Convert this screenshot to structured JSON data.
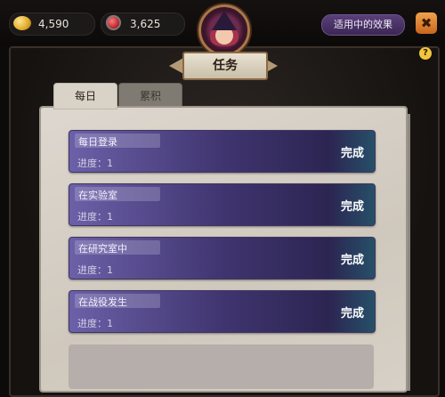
{
  "currency": {
    "gold": "4,590",
    "potion": "3,625"
  },
  "header": {
    "effects_button": "适用中的效果",
    "close_label": "✖",
    "title": "任务",
    "help_label": "?"
  },
  "tabs": [
    {
      "label": "每日"
    },
    {
      "label": "累积"
    }
  ],
  "tasks": [
    {
      "name": "每日登录",
      "progress": "进度：1",
      "action": "完成"
    },
    {
      "name": "在实验室",
      "progress": "进度：1",
      "action": "完成"
    },
    {
      "name": "在研究室中",
      "progress": "进度：1",
      "action": "完成"
    },
    {
      "name": "在战役发生",
      "progress": "进度：1",
      "action": "完成"
    }
  ]
}
